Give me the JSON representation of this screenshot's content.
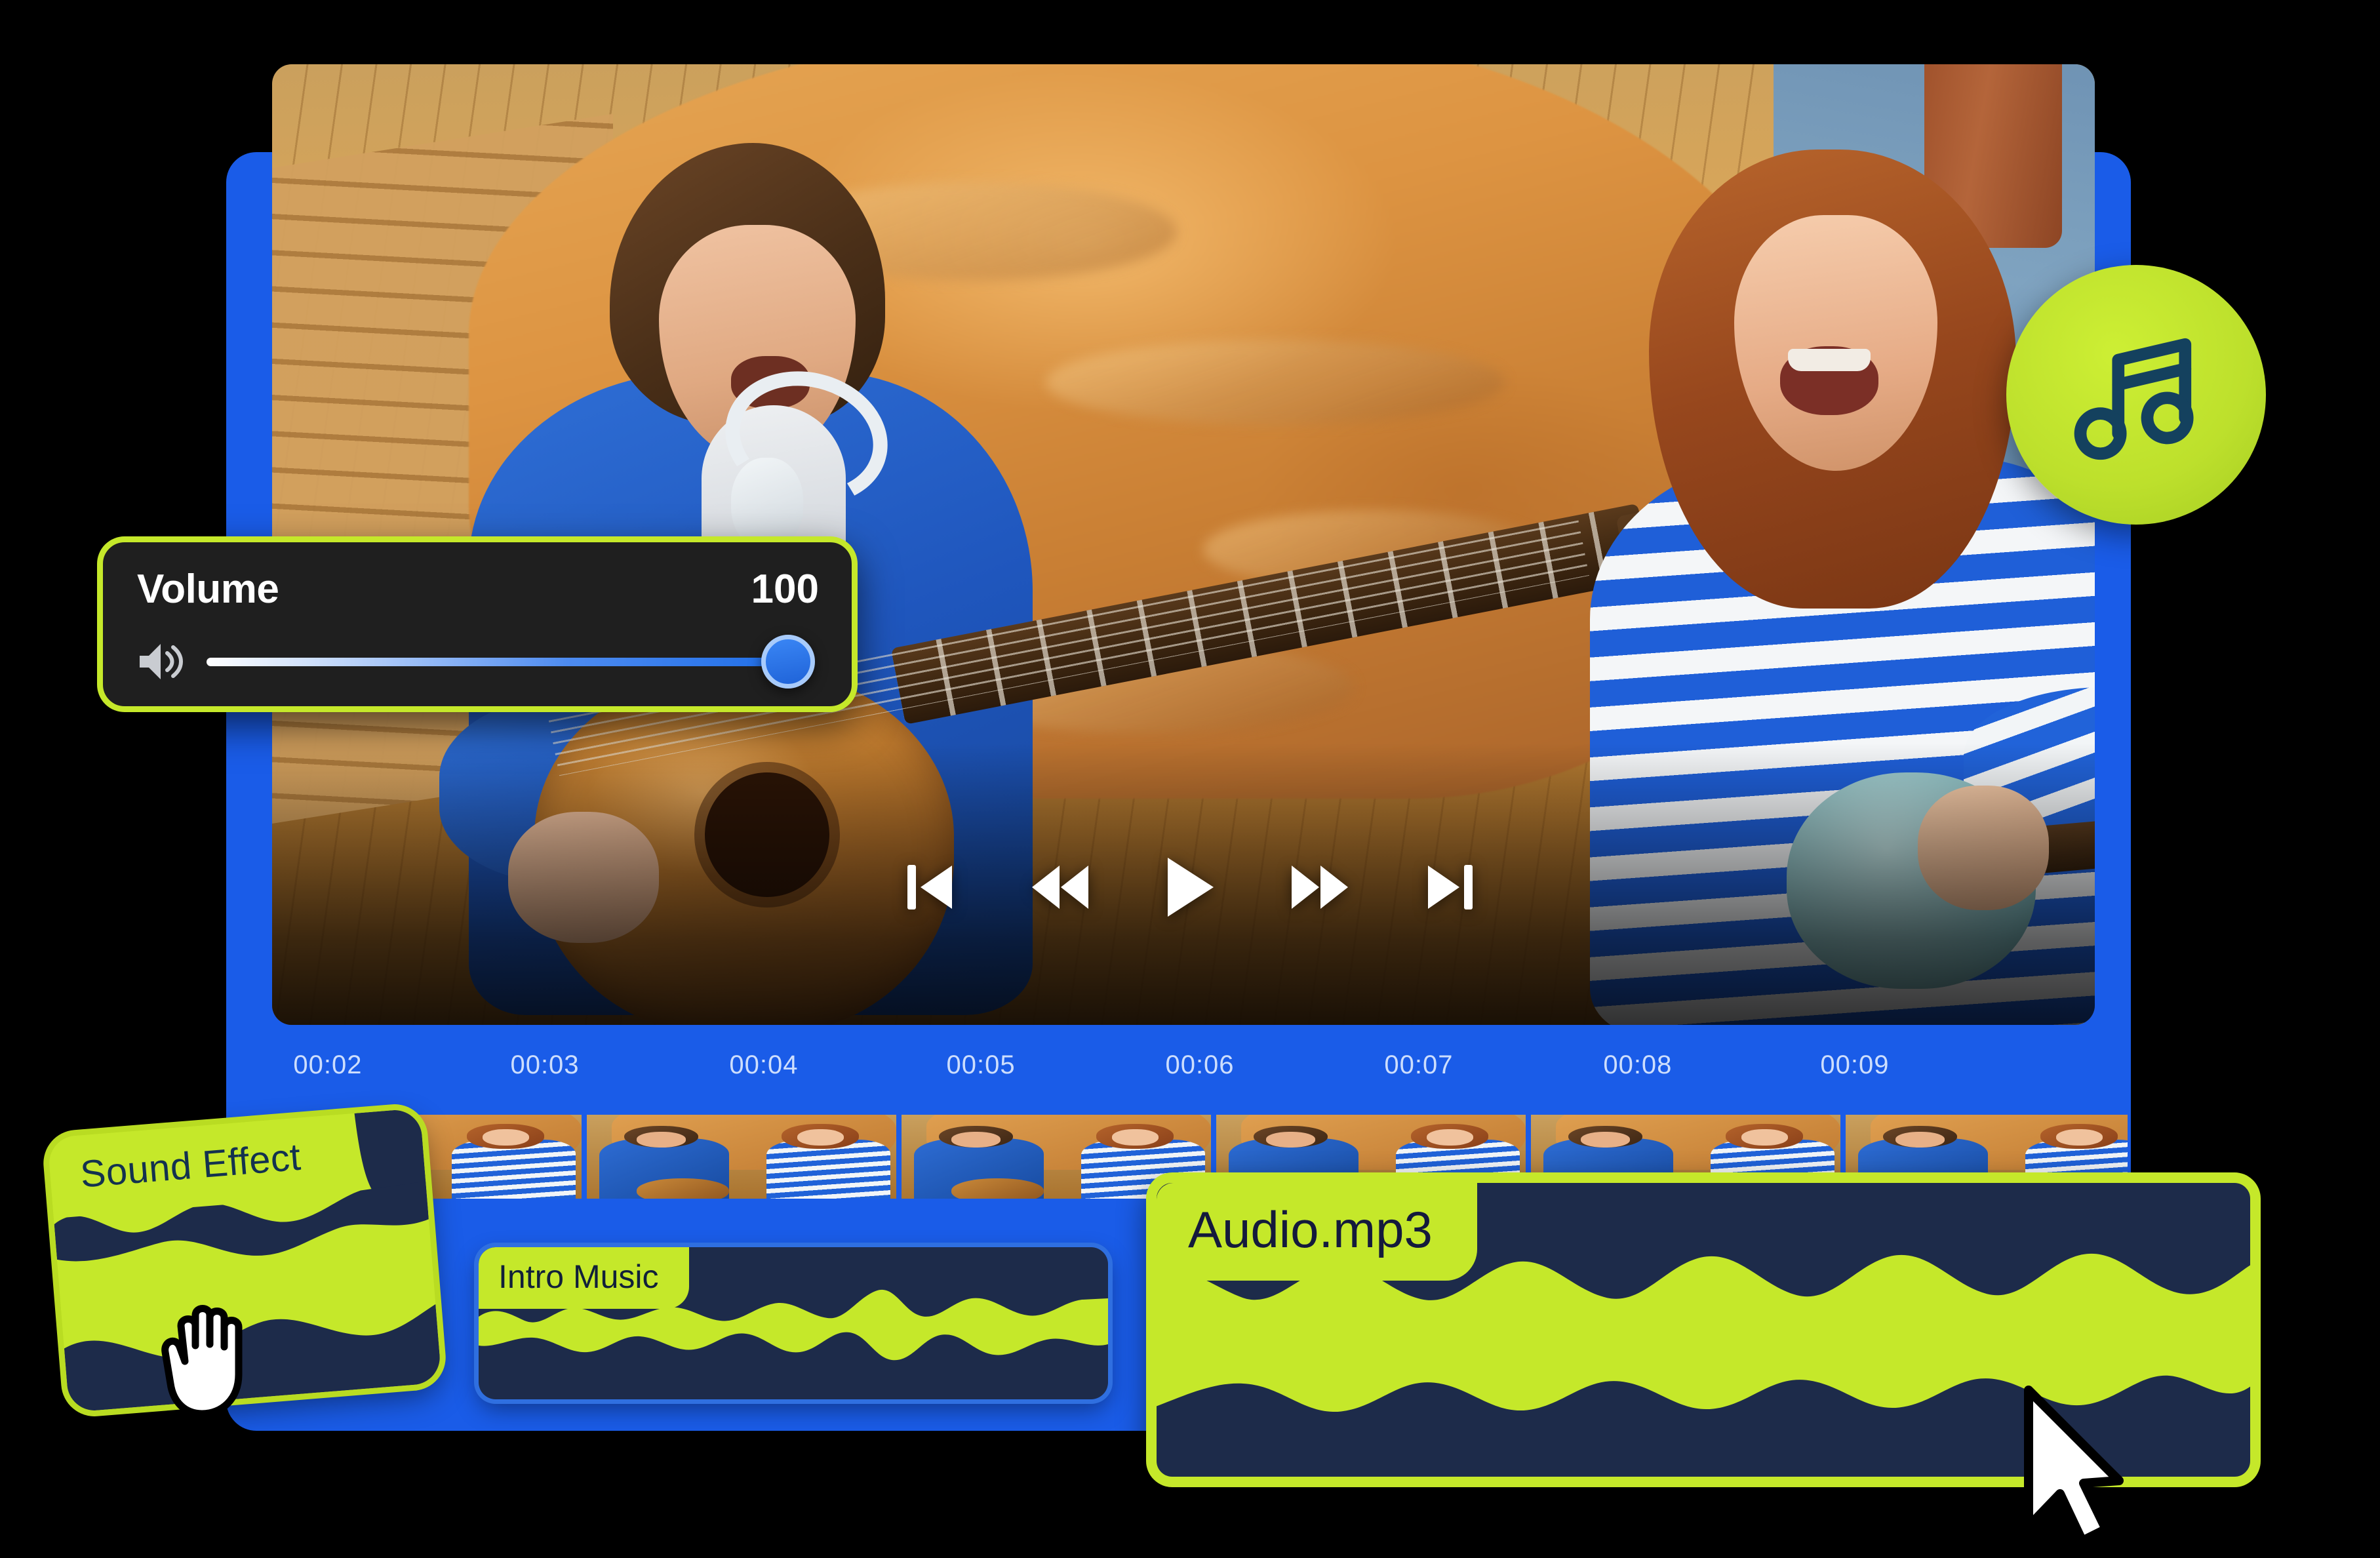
{
  "app": {
    "name": "video-editor",
    "frame_color": "#1a5ce8",
    "accent_lime": "#c5e82a",
    "panel_dark": "#1f1f1f",
    "clip_navy": "#1d2b4a"
  },
  "video_preview": {
    "description": "Two young musicians sitting on a wooden floor beside an orange duvet; a man in a blue shirt plays acoustic guitar while a woman in a blue-and-white striped shirt plays a ukulele, both singing."
  },
  "playback_controls": [
    {
      "name": "skip-back",
      "label": "Skip to start",
      "icon": "skip-back-icon"
    },
    {
      "name": "rewind",
      "label": "Rewind",
      "icon": "rewind-icon"
    },
    {
      "name": "play",
      "label": "Play",
      "icon": "play-icon"
    },
    {
      "name": "fast-forward",
      "label": "Fast forward",
      "icon": "fast-forward-icon"
    },
    {
      "name": "skip-forward",
      "label": "Skip to end",
      "icon": "skip-forward-icon"
    }
  ],
  "volume_panel": {
    "title": "Volume",
    "value": "100",
    "value_number": 100,
    "min": 0,
    "max": 100,
    "fill_percent": 100,
    "speaker_icon": "speaker-wave-icon",
    "border_color": "#c5e82a",
    "thumb_color": "#2f72e6"
  },
  "music_badge": {
    "icon": "music-note-icon",
    "background": "#bde02c",
    "icon_color": "#14415e"
  },
  "timeline": {
    "ticks": [
      {
        "label": "00:02",
        "pos_percent": 3.0
      },
      {
        "label": "00:03",
        "pos_percent": 14.7
      },
      {
        "label": "00:04",
        "pos_percent": 26.5
      },
      {
        "label": "00:05",
        "pos_percent": 38.2
      },
      {
        "label": "00:06",
        "pos_percent": 50.0
      },
      {
        "label": "00:07",
        "pos_percent": 61.8
      },
      {
        "label": "00:08",
        "pos_percent": 73.6
      },
      {
        "label": "00:09",
        "pos_percent": 85.3
      }
    ]
  },
  "clips": {
    "sound_effect": {
      "label": "Sound Effect",
      "label_bg": "#c5e82a",
      "label_color": "#13324f",
      "card_color": "#c5e82a",
      "wave_color": "#1d2b4a",
      "selected": true,
      "cursor": "grab-hand-cursor"
    },
    "intro_music": {
      "label": "Intro Music",
      "label_bg": "#c5e82a",
      "label_color": "#11203a",
      "card_color": "#1d2b4a",
      "wave_color": "#c5e82a",
      "selected": false
    },
    "audio_mp3": {
      "label": "Audio.mp3",
      "label_bg": "#c5e82a",
      "label_color": "#141a3c",
      "card_color": "#1d2b4a",
      "wave_color": "#c5e82a",
      "selected": true,
      "cursor": "arrow-pointer-cursor"
    }
  }
}
